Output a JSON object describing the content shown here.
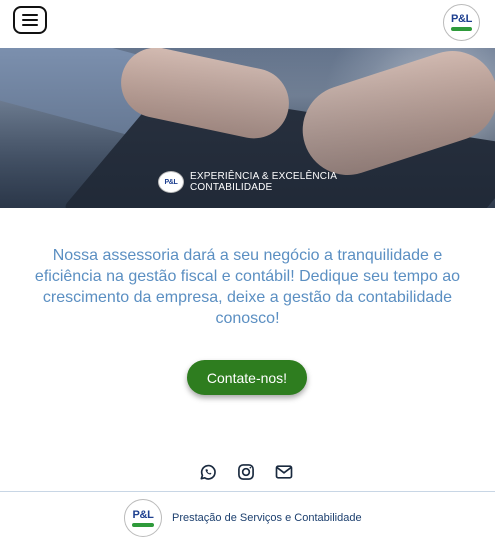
{
  "header": {
    "menu_icon": "hamburger-menu-icon",
    "logo_text": "P&L"
  },
  "hero": {
    "caption_line1": "EXPERIÊNCIA & EXCELÊNCIA",
    "caption_line2": "CONTABILIDADE",
    "logo_text": "P&L",
    "slides": 3,
    "active_slide": 1
  },
  "main": {
    "intro": "Nossa assessoria dará a seu negócio a tranquilidade e eficiência na gestão fiscal e contábil! Dedique seu tempo ao crescimento da empresa, deixe a gestão da contabilidade conosco!",
    "cta_label": "Contate-nos!"
  },
  "social": [
    "whatsapp-icon",
    "instagram-icon",
    "mail-icon"
  ],
  "footer": {
    "logo_text": "P&L",
    "text": "Prestação de Serviços e Contabilidade"
  },
  "colors": {
    "accent_green": "#2e7d1f",
    "text_blue": "#5b8fc2",
    "brand_blue": "#1d3f8f"
  }
}
